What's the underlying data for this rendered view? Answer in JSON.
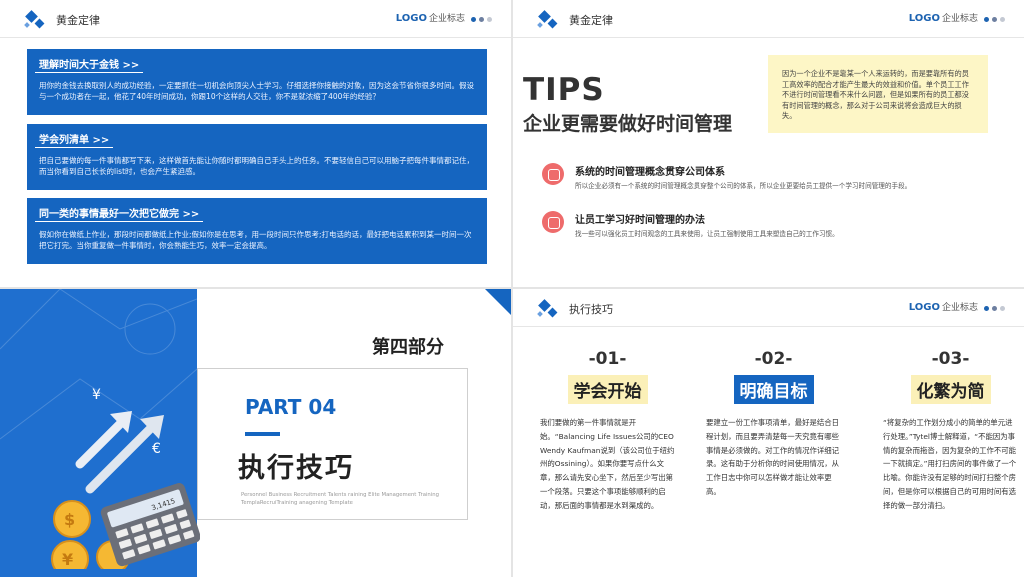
{
  "common": {
    "header_title": "黄金定律",
    "header_title_s4": "执行技巧",
    "logo": "LOGO",
    "logo_sub": "企业标志",
    "colors": {
      "brand_blue": "#1565c0",
      "accent_red": "#ee6b6b",
      "note_yellow": "#fdf6c6"
    }
  },
  "slide1": {
    "blocks": [
      {
        "title": "理解时间大于金钱 >>",
        "body": "用你的金钱去换取别人的成功经验，一定要抓住一切机会向顶尖人士学习。仔细选择你接触的对象，因为这会节省你很多时间。假设与一个成功者在一起，他花了40年时间成功，你跟10个这样的人交往，你不是就浓缩了400年的经验？"
      },
      {
        "title": "学会列清单 >>",
        "body": "把自己要做的每一件事情都写下来，这样做首先能让你随时都明确自己手头上的任务。不要轻信自己可以用脑子把每件事情都记住，而当你看到自己长长的list时，也会产生紧迫感。"
      },
      {
        "title": "同一类的事情最好一次把它做完 >>",
        "body": "假如你在做纸上作业，那段时间都做纸上作业;假如你是在思考，用一段时间只作思考;打电话的话，最好把电话累积到某一时间一次把它打完。当你重复做一件事情时，你会熟能生巧，效率一定会提高。"
      }
    ]
  },
  "slide2": {
    "tips": "TIPS",
    "subtitle": "企业更需要做好时间管理",
    "note": "因为一个企业不是靠某一个人来运转的，而是要靠所有的员工高效率的配合才能产生最大的效益和价值。单个员工工作不进行时间管理看不来什么问题，但是如果所有的员工都没有时间管理的概念，那么对于公司来说将会造成巨大的损失。",
    "items": [
      {
        "title": "系统的时间管理概念贯穿公司体系",
        "body": "所以企业必须有一个系统的时间管理概念贯穿整个公司的体系，所以企业更要给员工提供一个学习时间管理的手段。"
      },
      {
        "title": "让员工学习好时间管理的办法",
        "body": "找一些可以强化员工时间观念的工具来使用，让员工强制使用工具来塑造自己的工作习惯。"
      }
    ]
  },
  "slide3": {
    "section": "第四部分",
    "part": "PART 04",
    "title": "执行技巧",
    "small_text": "Personnel Business Recruitment Talents raining Elite Management Training TemplaRecruiTraining anagening Template",
    "currency_yen": "¥",
    "currency_euro": "€",
    "calc_display": "3,1415"
  },
  "slide4": {
    "columns": [
      {
        "num": "-01-",
        "heading": "学会开始",
        "style": "yellow",
        "body": "我们要做的第一件事情就是开始。“Balancing Life Issues公司的CEO Wendy Kaufman说到（该公司位于纽约州的Ossining）。如果你要写点什么文章，那么请先安心坐下，然后至少写出第一个段落。只要这个事项能够顺利的启动，那后面的事情都是水到渠成的。"
      },
      {
        "num": "-02-",
        "heading": "明确目标",
        "style": "blue",
        "body": "要建立一份工作事项清单，最好是结合日程计划，而且要弄清楚每一天究竟有哪些事情是必须做的。对工作的情况作详细记录。这有助于分析你的时间使用情况，从工作日志中你可以怎样做才能让效率更高。"
      },
      {
        "num": "-03-",
        "heading": "化繁为简",
        "style": "yellow",
        "body": "“将复杂的工作划分成小的简单的单元进行处理。”Tytel博士解释道，“不能因为事情的复杂而拖沓，因为复杂的工作不可能一下就搞定。”用打扫房间的事件做了一个比喻。你能许没有足够的时间打扫整个房间，但是你可以根据自己的可用时间有选择的做一部分清扫。"
      }
    ]
  }
}
